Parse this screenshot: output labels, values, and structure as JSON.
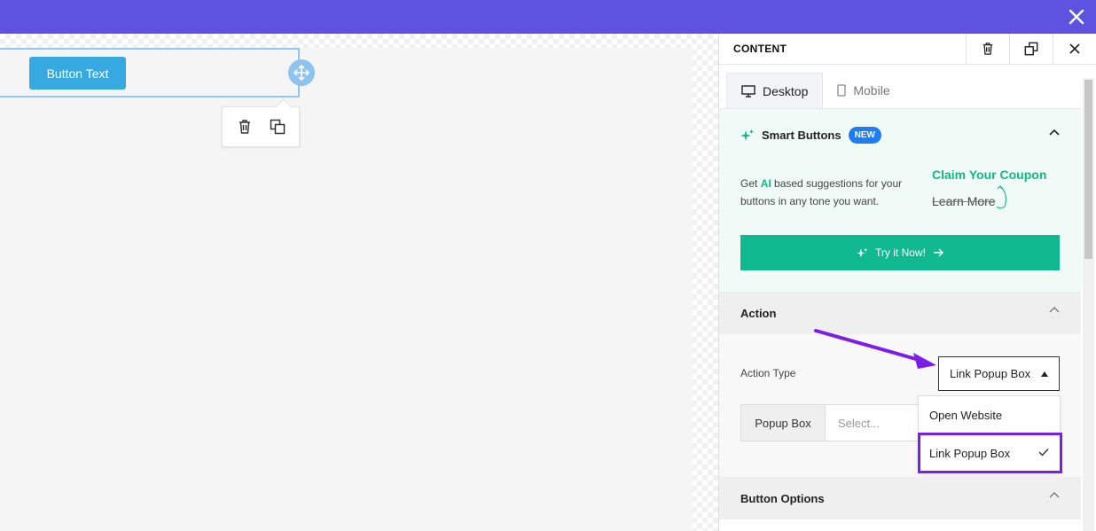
{
  "canvas": {
    "button_text": "Button Text"
  },
  "panel": {
    "title": "CONTENT",
    "tabs": [
      {
        "label": "Desktop",
        "icon": "monitor-icon",
        "active": true
      },
      {
        "label": "Mobile",
        "icon": "mobile-icon",
        "active": false
      }
    ],
    "smart_buttons": {
      "title": "Smart Buttons",
      "badge": "NEW",
      "desc_prefix": "Get ",
      "desc_ai": "AI",
      "desc_suffix": " based suggestions for your buttons in any tone you want.",
      "example_primary": "Claim Your Coupon",
      "example_secondary": "Learn More",
      "try_label": "Try it Now!"
    },
    "action": {
      "heading": "Action",
      "type_label": "Action Type",
      "type_value": "Link Popup Box",
      "popup_label": "Popup Box",
      "popup_placeholder": "Select...",
      "options": [
        {
          "label": "Open Website",
          "selected": false
        },
        {
          "label": "Link Popup Box",
          "selected": true
        }
      ]
    },
    "button_options": {
      "heading": "Button Options"
    }
  },
  "colors": {
    "topbar": "#5e52e0",
    "button": "#36a9e1",
    "accent_green": "#10b981",
    "badge_blue": "#1d7df2",
    "highlight_purple": "#7c1dea"
  }
}
